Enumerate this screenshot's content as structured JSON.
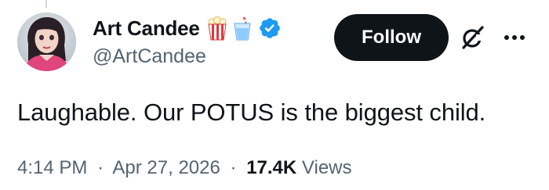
{
  "author": {
    "display_name": "Art Candee",
    "handle": "@ArtCandee",
    "name_emojis": [
      "popcorn-icon",
      "drink-cup-icon"
    ],
    "verified_badge": "verified-badge-icon",
    "verified_color": "#1d9bf0"
  },
  "actions": {
    "follow_label": "Follow",
    "grok_icon": "grok-icon",
    "more_icon": "more-options-icon"
  },
  "tweet": {
    "text": "Laughable. Our POTUS is the biggest child."
  },
  "meta": {
    "time": "4:14 PM",
    "separator": "·",
    "date": "Apr 27, 2026",
    "views_count": "17.4K",
    "views_label": "Views"
  },
  "colors": {
    "text_primary": "#0f1419",
    "text_secondary": "#536471",
    "follow_bg": "#0f1419",
    "follow_text": "#ffffff"
  }
}
